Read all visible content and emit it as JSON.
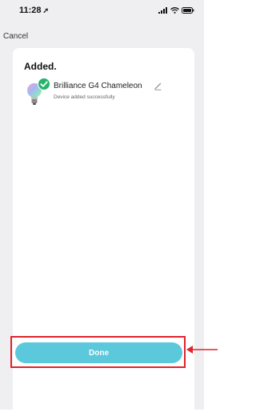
{
  "status_bar": {
    "time": "11:28",
    "location_icon": "location-arrow-icon",
    "signal_icon": "cellular-signal-icon",
    "wifi_icon": "wifi-icon",
    "battery_icon": "battery-icon"
  },
  "nav": {
    "cancel_label": "Cancel"
  },
  "card": {
    "title": "Added.",
    "device": {
      "name": "Brilliance G4 Chameleon",
      "status": "Device added successfully",
      "icon": "bulb-icon",
      "badge_icon": "check-icon",
      "edit_icon": "pencil-icon"
    }
  },
  "footer": {
    "done_label": "Done"
  },
  "colors": {
    "done_button": "#5bc8dc",
    "highlight": "#e0242b",
    "success": "#24b46b",
    "background": "#efeff2"
  }
}
